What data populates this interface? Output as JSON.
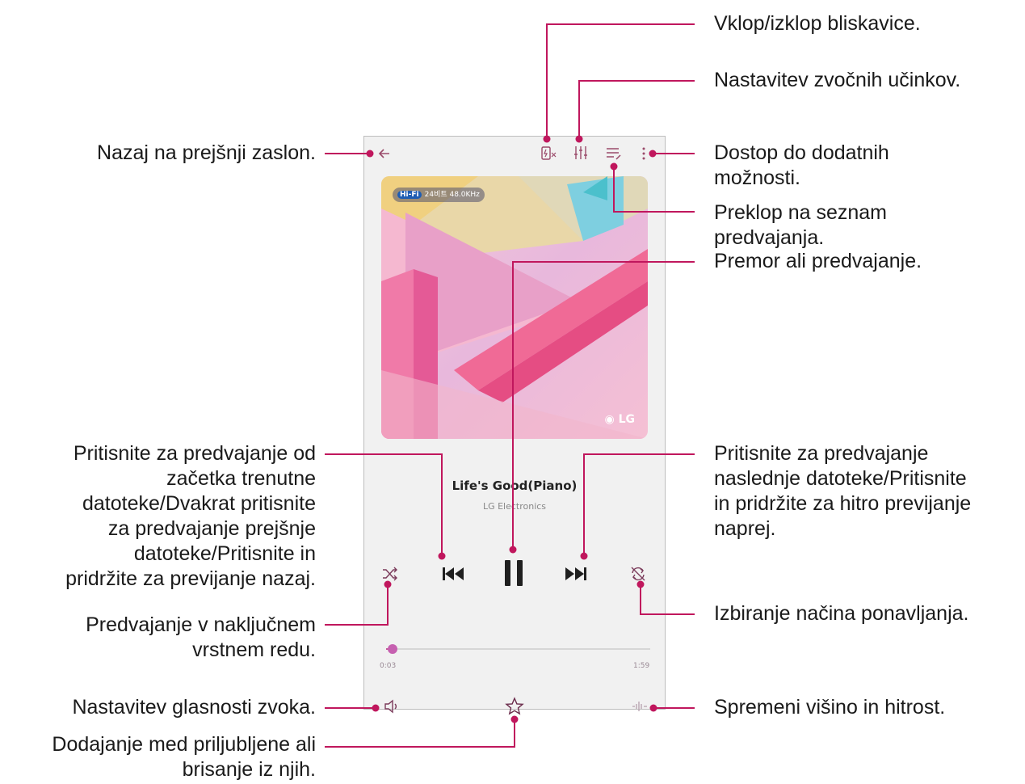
{
  "player": {
    "hires_badge": "24비트 48.0KHz",
    "hires_tag": "Hi-Fi",
    "art_logo": "LG",
    "song_title": "Life's Good(Piano)",
    "artist": "LG Electronics",
    "time_elapsed": "0:03",
    "time_total": "1:59",
    "progress": 0.025,
    "accent_color": "#c3579a"
  },
  "icons": {
    "back": "back-arrow-icon",
    "flash": "flash-toggle-icon",
    "equalizer": "equalizer-icon",
    "playlist": "playlist-icon",
    "more": "more-options-icon",
    "shuffle": "shuffle-icon",
    "previous": "skip-previous-icon",
    "pause": "pause-icon",
    "next": "skip-next-icon",
    "repeat": "repeat-icon",
    "volume": "volume-icon",
    "favorite": "star-icon",
    "pitch": "pitch-speed-icon"
  },
  "callouts": {
    "flash": "Vklop/izklop bliskavice.",
    "sound_effects": "Nastavitev zvočnih učinkov.",
    "back": "Nazaj na prejšnji zaslon.",
    "more_options": "Dostop do dodatnih\nmožnosti.",
    "playlist": "Preklop na seznam\npredvajanja.",
    "pause_play": "Premor ali predvajanje.",
    "previous": "Pritisnite za predvajanje od\nzačetka trenutne\ndatoteke/Dvakrat pritisnite\nza predvajanje prejšnje\ndatoteke/Pritisnite in\npridržite za previjanje nazaj.",
    "next": "Pritisnite za predvajanje\nnaslednje datoteke/Pritisnite\nin pridržite za hitro previjanje\nnaprej.",
    "repeat": "Izbiranje načina ponavljanja.",
    "shuffle": "Predvajanje v naključnem\nvrstnem redu.",
    "volume": "Nastavitev glasnosti zvoka.",
    "pitch_speed": "Spremeni višino in hitrost.",
    "favorites": "Dodajanje med priljubljene ali\nbrisanje iz njih."
  }
}
